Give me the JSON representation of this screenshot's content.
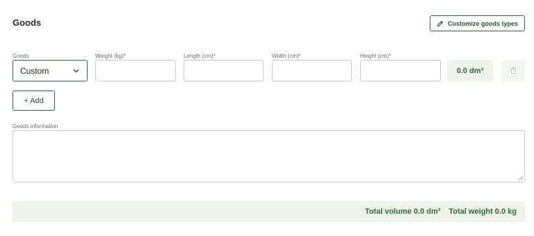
{
  "section": {
    "title": "Goods"
  },
  "customize": {
    "label": "Customize goods types",
    "icon": "pencil-icon"
  },
  "goods_row": {
    "goods_label": "Goods",
    "goods_selected": "Custom",
    "weight_label": "Weight (kg)*",
    "length_label": "Length (cm)*",
    "width_label": "Width (cm)*",
    "height_label": "Height (cm)*",
    "volume_value": "0.0 dm³"
  },
  "add_button": {
    "label": "+ Add"
  },
  "info": {
    "label": "Goods information"
  },
  "totals": {
    "volume": "Total volume 0.0 dm³",
    "weight": "Total weight 0.0 kg"
  },
  "colors": {
    "accent": "#2e6b43",
    "accent_light": "#eef5e8"
  }
}
